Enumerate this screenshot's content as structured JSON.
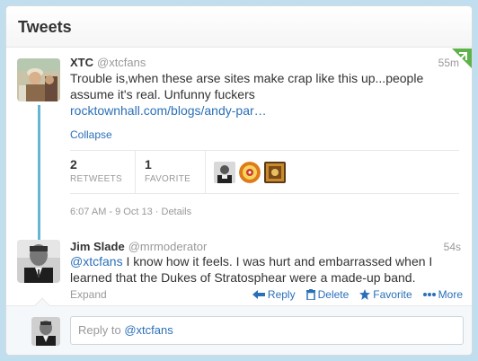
{
  "header": {
    "title": "Tweets"
  },
  "tweet1": {
    "name": "XTC",
    "handle": "@xtcfans",
    "time": "55m",
    "text": "Trouble is,when these arse sites make crap like this up...people assume it's real. Unfunny fuckers",
    "link": "rocktownhall.com/blogs/andy-par…",
    "collapse": "Collapse",
    "retweets_count": "2",
    "retweets_label": "RETWEETS",
    "favorites_count": "1",
    "favorites_label": "FAVORITE",
    "timestamp": "6:07 AM - 9 Oct 13",
    "details_sep": " · ",
    "details": "Details"
  },
  "tweet2": {
    "name": "Jim Slade",
    "handle": "@mrmoderator",
    "time": "54s",
    "mention": "@xtcfans",
    "text": " I know how it feels. I was hurt and embarrassed when I learned that the Dukes of Stratosphear were a made-up band.",
    "expand": "Expand",
    "actions": {
      "reply": "Reply",
      "delete": "Delete",
      "favorite": "Favorite",
      "more": "More"
    }
  },
  "reply_box": {
    "prefix": "Reply to ",
    "mention": "@xtcfans"
  },
  "colors": {
    "link": "#2a70b8",
    "connector": "#66b5d2",
    "corner": "#5fb14a"
  }
}
